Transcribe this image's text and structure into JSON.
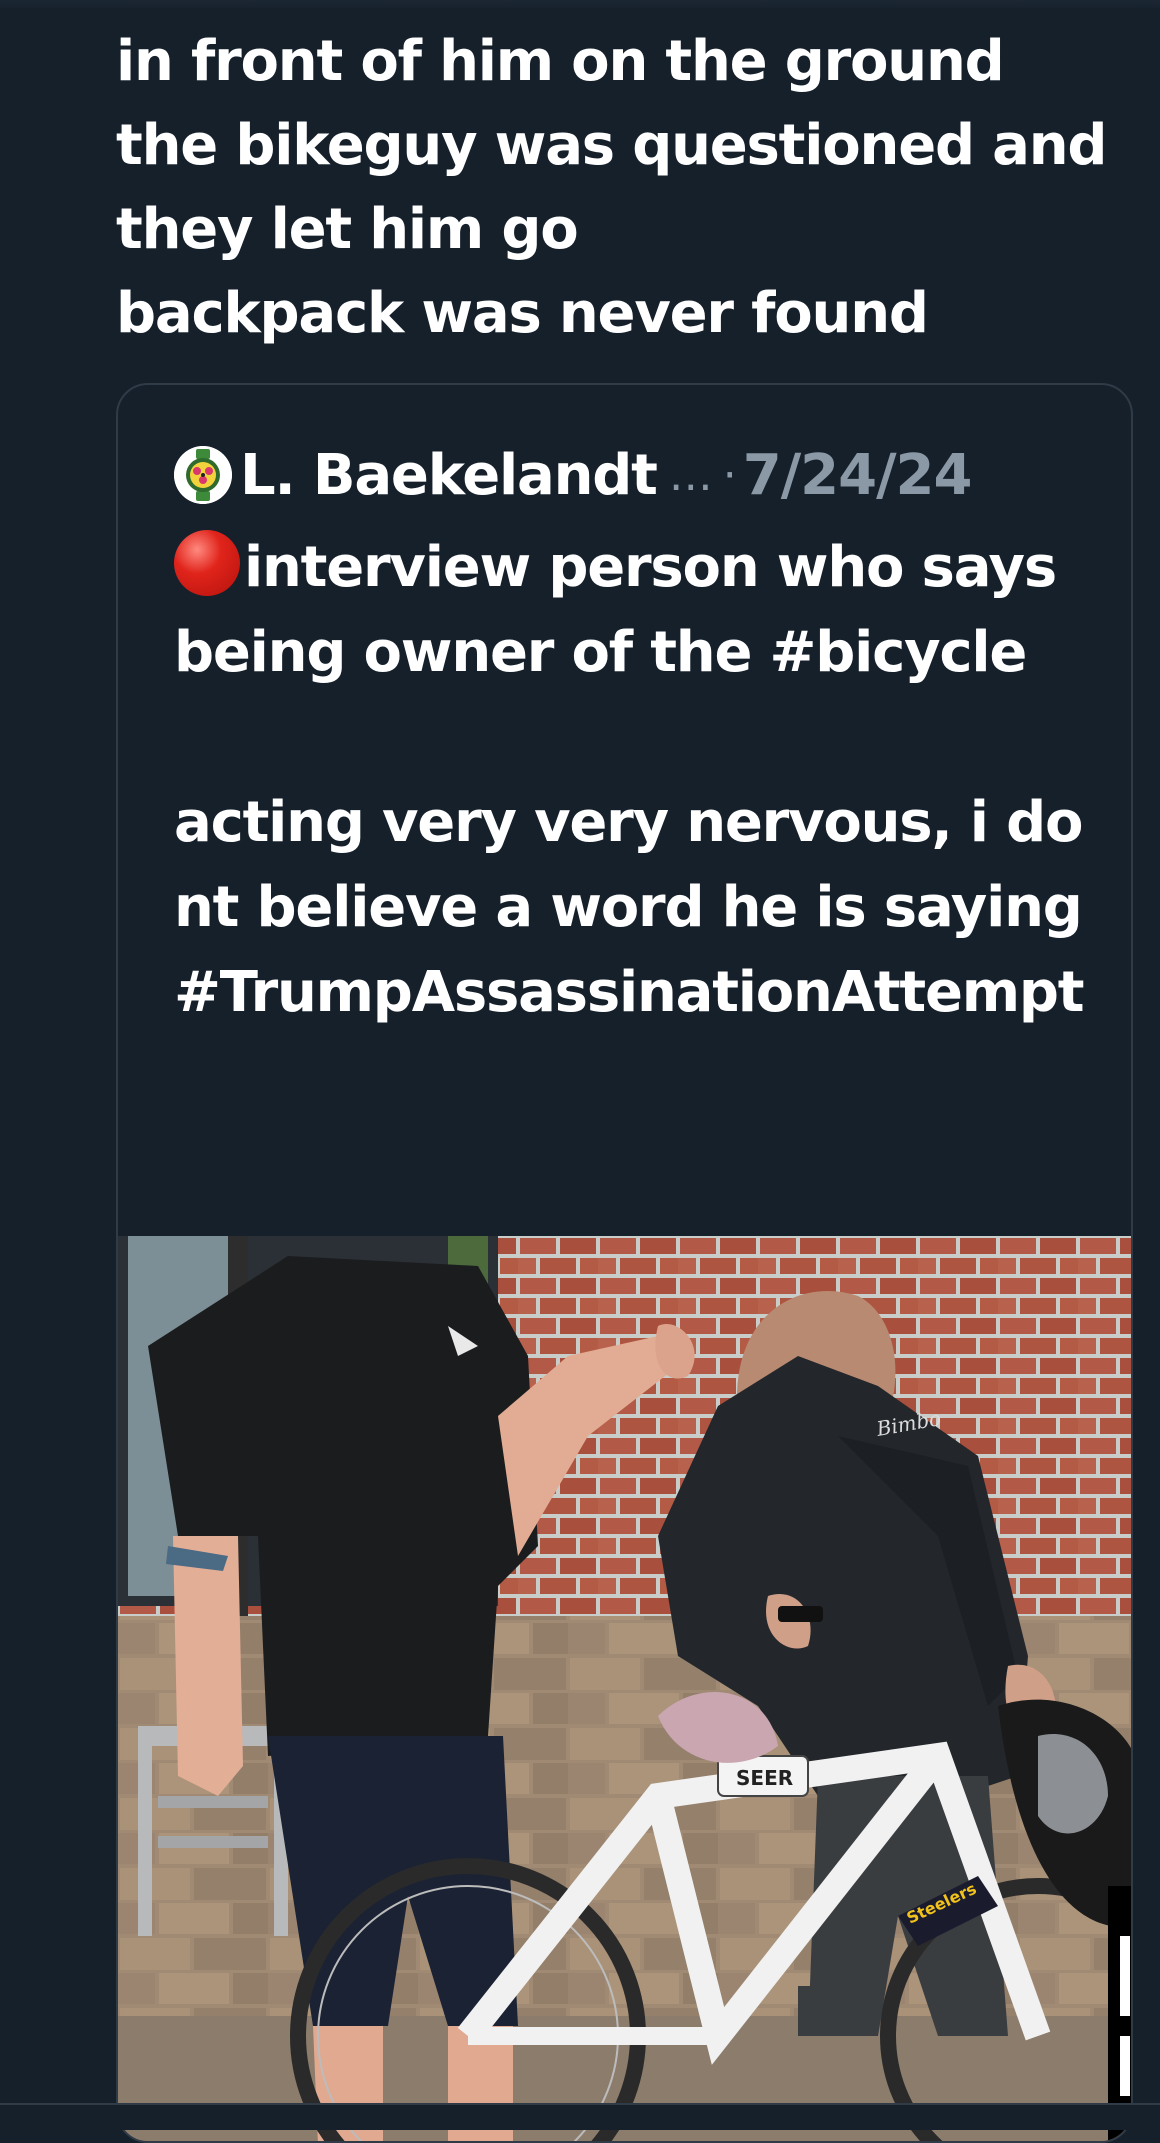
{
  "tweet": {
    "text": "in front of him on the ground\nthe bikeguy was questioned and\nthey let him go\nbackpack was never found"
  },
  "quote": {
    "author_name": "L. Baekelandt",
    "author_truncated": "…",
    "separator": "·",
    "date": "7/24/24",
    "text": "interview person who says being owner of the #bicycle\n\nacting very very nervous, i dont believe a word he is saying #TrumpAssassinationAttempt"
  },
  "media": {
    "description_icon": "video-frame",
    "bike_brand_text": "SEER",
    "sticker_text": "Steelers",
    "hoodie_text": "Bimbo Graphics"
  },
  "colors": {
    "background": "#15202b",
    "border": "#2f3b47",
    "secondary_text": "#8b98a5",
    "primary_text": "#ffffff"
  }
}
